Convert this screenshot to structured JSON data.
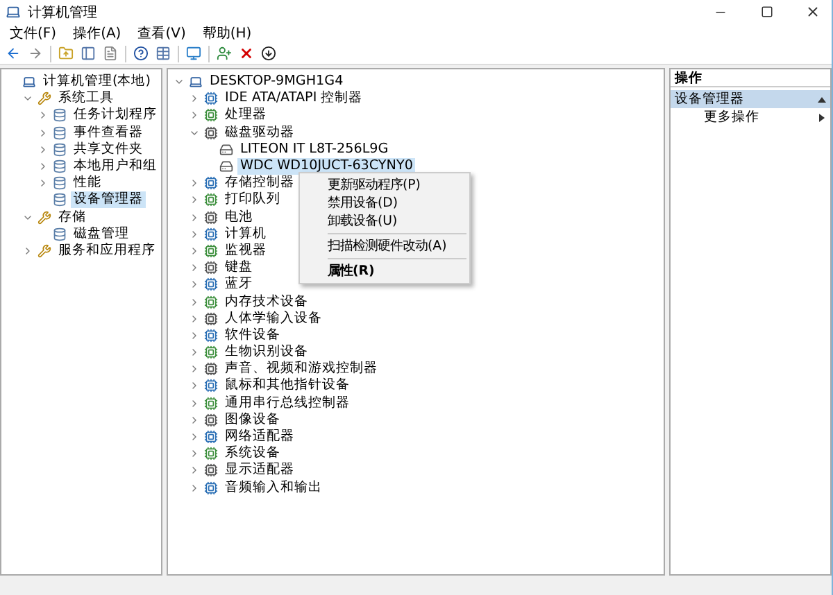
{
  "window": {
    "title": "计算机管理"
  },
  "menu": [
    "文件(F)",
    "操作(A)",
    "查看(V)",
    "帮助(H)"
  ],
  "left_tree": [
    {
      "label": "计算机管理(本地)",
      "selected": false,
      "children": [
        {
          "label": "系统工具",
          "expanded": true,
          "selected": false,
          "children": [
            {
              "label": "任务计划程序",
              "expanded": false,
              "selected": false
            },
            {
              "label": "事件查看器",
              "expanded": false,
              "selected": false
            },
            {
              "label": "共享文件夹",
              "expanded": false,
              "selected": false
            },
            {
              "label": "本地用户和组",
              "expanded": false,
              "selected": false
            },
            {
              "label": "性能",
              "expanded": false,
              "selected": false
            },
            {
              "label": "设备管理器",
              "selected": true
            }
          ]
        },
        {
          "label": "存储",
          "expanded": true,
          "selected": false,
          "children": [
            {
              "label": "磁盘管理",
              "selected": false
            }
          ]
        },
        {
          "label": "服务和应用程序",
          "expanded": false,
          "selected": false
        }
      ]
    }
  ],
  "device_tree": [
    {
      "label": "DESKTOP-9MGH1G4",
      "expanded": true,
      "selected": false,
      "children": [
        {
          "label": "IDE ATA/ATAPI 控制器",
          "expanded": false,
          "selected": false
        },
        {
          "label": "处理器",
          "expanded": false,
          "selected": false
        },
        {
          "label": "磁盘驱动器",
          "expanded": true,
          "selected": false,
          "children": [
            {
              "label": "LITEON IT L8T-256L9G",
              "selected": false
            },
            {
              "label": "WDC WD10JUCT-63CYNY0",
              "selected": true
            }
          ]
        },
        {
          "label": "存储控制器",
          "expanded": false,
          "selected": false
        },
        {
          "label": "打印队列",
          "expanded": false,
          "selected": false
        },
        {
          "label": "电池",
          "expanded": false,
          "selected": false
        },
        {
          "label": "计算机",
          "expanded": false,
          "selected": false
        },
        {
          "label": "监视器",
          "expanded": false,
          "selected": false
        },
        {
          "label": "键盘",
          "expanded": false,
          "selected": false
        },
        {
          "label": "蓝牙",
          "expanded": false,
          "selected": false
        },
        {
          "label": "内存技术设备",
          "expanded": false,
          "selected": false
        },
        {
          "label": "人体学输入设备",
          "expanded": false,
          "selected": false
        },
        {
          "label": "软件设备",
          "expanded": false,
          "selected": false
        },
        {
          "label": "生物识别设备",
          "expanded": false,
          "selected": false
        },
        {
          "label": "声音、视频和游戏控制器",
          "expanded": false,
          "selected": false
        },
        {
          "label": "鼠标和其他指针设备",
          "expanded": false,
          "selected": false
        },
        {
          "label": "通用串行总线控制器",
          "expanded": false,
          "selected": false
        },
        {
          "label": "图像设备",
          "expanded": false,
          "selected": false
        },
        {
          "label": "网络适配器",
          "expanded": false,
          "selected": false
        },
        {
          "label": "系统设备",
          "expanded": false,
          "selected": false
        },
        {
          "label": "显示适配器",
          "expanded": false,
          "selected": false
        },
        {
          "label": "音频输入和输出",
          "expanded": false,
          "selected": false
        }
      ]
    }
  ],
  "context_menu": [
    {
      "kind": "item",
      "label": "更新驱动程序(P)",
      "default": false
    },
    {
      "kind": "item",
      "label": "禁用设备(D)",
      "default": false
    },
    {
      "kind": "item",
      "label": "卸载设备(U)",
      "default": false
    },
    {
      "kind": "separator"
    },
    {
      "kind": "item",
      "label": "扫描检测硬件改动(A)",
      "default": false
    },
    {
      "kind": "separator"
    },
    {
      "kind": "item",
      "label": "属性(R)",
      "default": true
    }
  ],
  "actions": {
    "header": "操作",
    "section": "设备管理器",
    "items": [
      "更多操作"
    ]
  }
}
